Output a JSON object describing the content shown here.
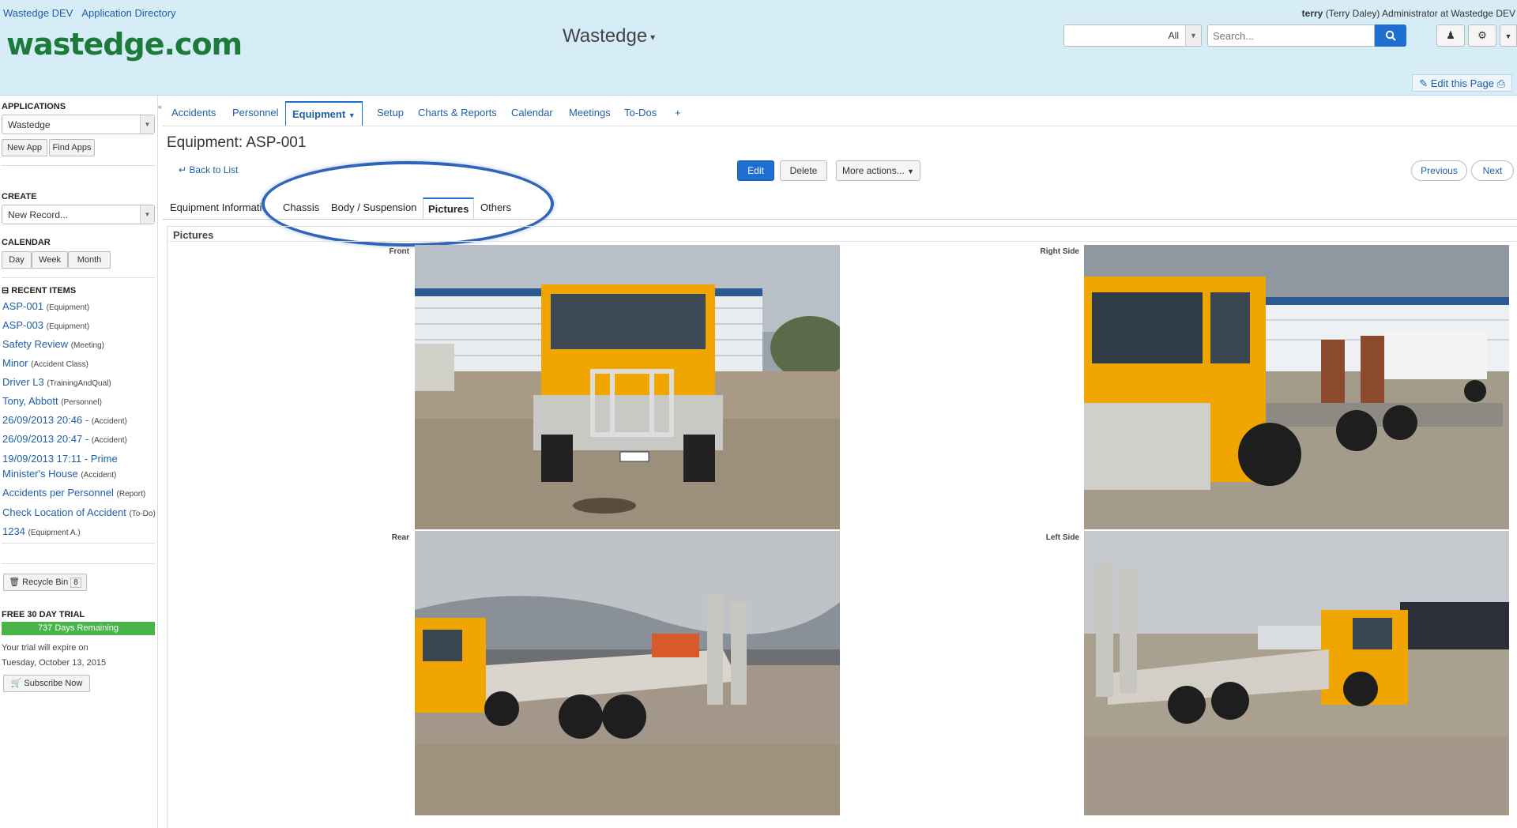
{
  "header": {
    "links": [
      "Wastedge DEV",
      "Application Directory"
    ],
    "user_name": "terry",
    "user_detail": "(Terry Daley) Administrator at Wastedge DEV",
    "logo_text": "wastedge.com",
    "app_title": "Wastedge",
    "search_scope": "All",
    "search_placeholder": "Search...",
    "edit_page_label": "Edit this Page"
  },
  "sidebar": {
    "applications_heading": "APPLICATIONS",
    "application_selected": "Wastedge",
    "new_app_label": "New App",
    "find_apps_label": "Find Apps",
    "create_heading": "CREATE",
    "create_placeholder": "New Record...",
    "calendar_heading": "CALENDAR",
    "calendar_buttons": [
      "Day",
      "Week",
      "Month"
    ],
    "recent_heading": "RECENT ITEMS",
    "recent_items": [
      {
        "label": "ASP-001",
        "type": "(Equipment)"
      },
      {
        "label": "ASP-003",
        "type": "(Equipment)"
      },
      {
        "label": "Safety Review",
        "type": "(Meeting)"
      },
      {
        "label": "Minor",
        "type": "(Accident Class)"
      },
      {
        "label": "Driver L3",
        "type": "(TrainingAndQual)"
      },
      {
        "label": "Tony, Abbott",
        "type": "(Personnel)"
      },
      {
        "label": "26/09/2013 20:46 -",
        "type": "(Accident)"
      },
      {
        "label": "26/09/2013 20:47 -",
        "type": "(Accident)"
      },
      {
        "label": "19/09/2013 17:11 - Prime Minister's House",
        "type": "(Accident)"
      },
      {
        "label": "Accidents per Personnel",
        "type": "(Report)"
      },
      {
        "label": "Check Location of Accident",
        "type": "(To-Do)"
      },
      {
        "label": "1234",
        "type": "(Equipment A.)"
      }
    ],
    "recycle_bin_label": "Recycle Bin",
    "recycle_bin_count": "8",
    "trial_heading": "FREE 30 DAY TRIAL",
    "trial_bar_text": "737 Days Remaining",
    "trial_line1": "Your trial will expire on",
    "trial_line2": "Tuesday, October 13, 2015",
    "subscribe_label": "Subscribe Now"
  },
  "main": {
    "tabs": [
      "Accidents",
      "Personnel",
      "Equipment",
      "Setup",
      "Charts & Reports",
      "Calendar",
      "Meetings",
      "To-Dos",
      "+"
    ],
    "page_title": "Equipment: ASP-001",
    "back_label": "Back to List",
    "edit_label": "Edit",
    "delete_label": "Delete",
    "more_actions_label": "More actions...",
    "previous_label": "Previous",
    "next_label": "Next",
    "subtabs": [
      "Equipment Informati",
      "Chassis",
      "Body / Suspension",
      "Pictures",
      "Others"
    ],
    "section_title": "Pictures",
    "pictures": [
      {
        "label": "Front"
      },
      {
        "label": "Right Side"
      },
      {
        "label": "Rear"
      },
      {
        "label": "Left Side"
      }
    ]
  },
  "colors": {
    "header_bg": "#d6ecf7",
    "link": "#1f5fa8",
    "primary_button": "#1f6fd0",
    "trial_green": "#48b548",
    "annotation_ellipse": "#2f64b8",
    "truck_yellow": "#f0a500"
  }
}
